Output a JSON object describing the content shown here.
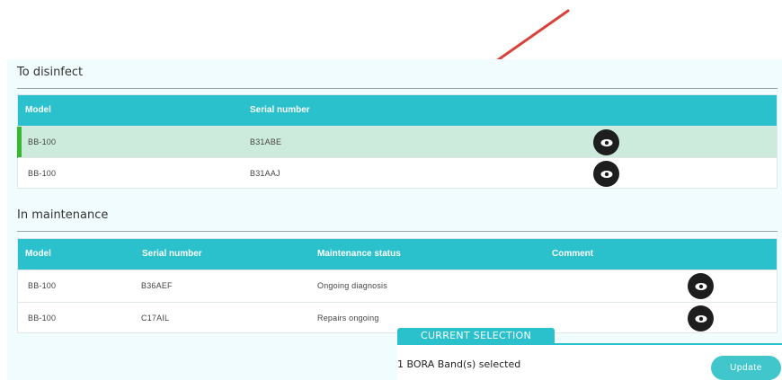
{
  "disinfect": {
    "title": "To disinfect",
    "columns": [
      "Model",
      "Serial number"
    ],
    "rows": [
      {
        "model": "BB-100",
        "serial": "B31ABE",
        "selected": true,
        "action_icon": "eye-icon"
      },
      {
        "model": "BB-100",
        "serial": "B31AAJ",
        "selected": false,
        "action_icon": "eye-icon"
      }
    ]
  },
  "maintenance": {
    "title": "In maintenance",
    "columns": [
      "Model",
      "Serial number",
      "Maintenance status",
      "Comment"
    ],
    "rows": [
      {
        "model": "BB-100",
        "serial": "B36AEF",
        "status": "Ongoing diagnosis",
        "comment": "",
        "action_icon": "eye-icon"
      },
      {
        "model": "BB-100",
        "serial": "C17AIL",
        "status": "Repairs ongoing",
        "comment": "",
        "action_icon": "eye-icon"
      }
    ]
  },
  "selection": {
    "tab_label": "CURRENT SELECTION",
    "summary": "1 BORA Band(s) selected",
    "update_label": "Update"
  },
  "colors": {
    "header": "#2ac1cc",
    "selected_row": "#cdebdd",
    "selected_marker": "#38b82c",
    "annotation_arrow": "#d9423a"
  }
}
